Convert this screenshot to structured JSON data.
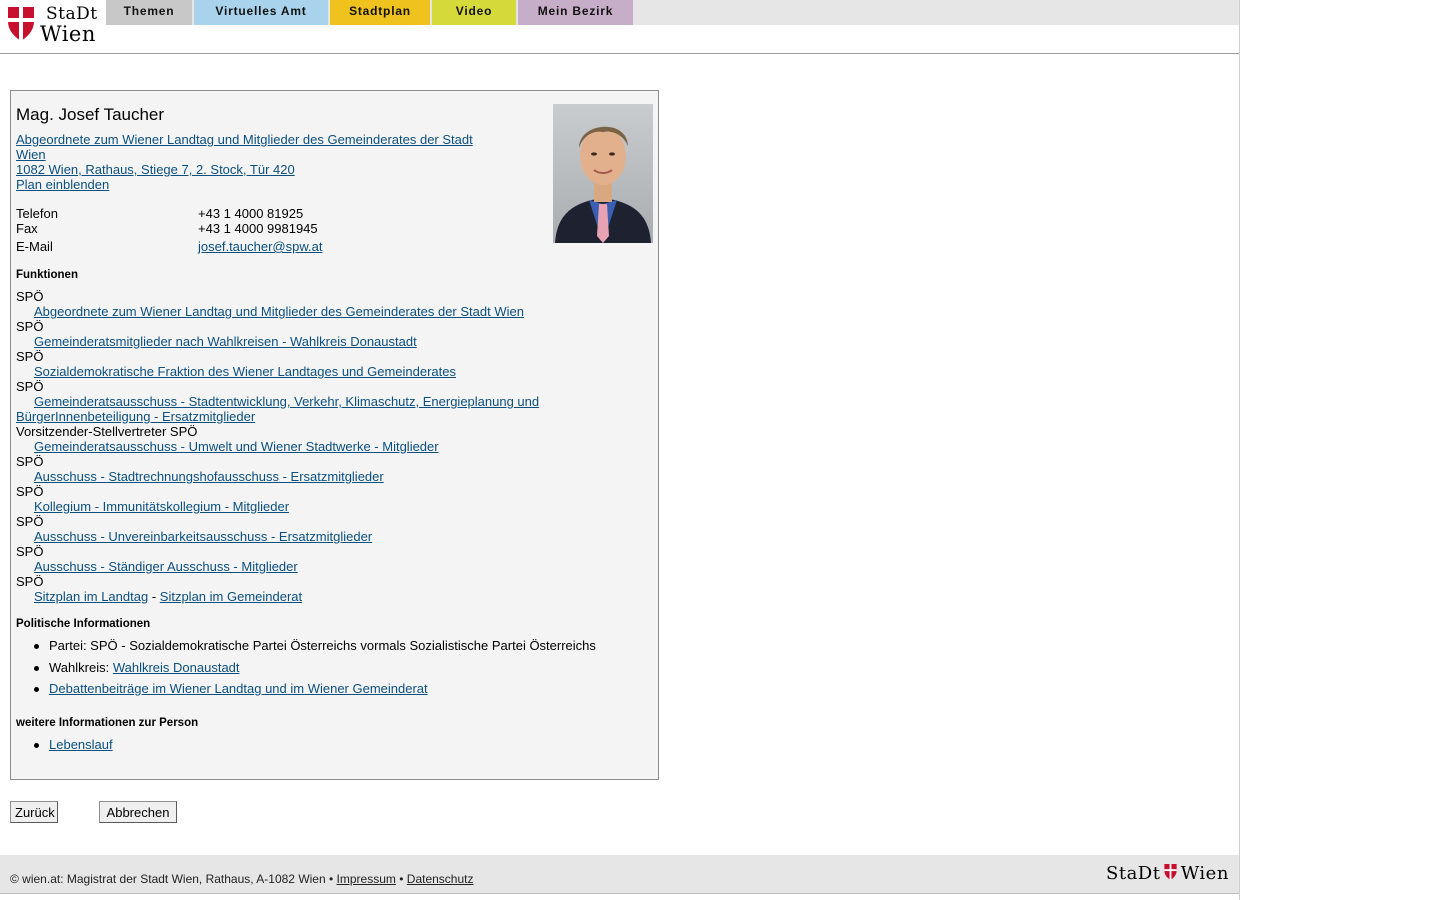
{
  "header": {
    "logo_line1": "StaDt",
    "logo_line2": "Wien",
    "nav": [
      {
        "label": "Themen",
        "color": "#c8c8c8"
      },
      {
        "label": "Virtuelles Amt",
        "color": "#a9d3ec"
      },
      {
        "label": "Stadtplan",
        "color": "#f0c21d"
      },
      {
        "label": "Video",
        "color": "#d6d93a"
      },
      {
        "label": "Mein Bezirk",
        "color": "#c7aec8"
      }
    ]
  },
  "person": {
    "name": "Mag. Josef Taucher",
    "role_link_line1": "Abgeordnete zum Wiener Landtag und Mitglieder des Gemeinderates der Stadt",
    "role_link_line2": "Wien",
    "address": "1082 Wien, Rathaus, Stiege 7, 2. Stock, Tür 420",
    "plan_link": "Plan einblenden",
    "contact": [
      {
        "label": "Telefon",
        "value": "+43 1 4000 81925"
      },
      {
        "label": "Fax",
        "value": "+43 1 4000 9981945"
      },
      {
        "label": "E-Mail",
        "value": "josef.taucher@spw.at"
      }
    ]
  },
  "functions": {
    "heading": "Funktionen",
    "items": [
      {
        "role": "SPÖ",
        "link": "Abgeordnete zum Wiener Landtag und Mitglieder des Gemeinderates der Stadt Wien"
      },
      {
        "role": "SPÖ",
        "link": "Gemeinderatsmitglieder nach Wahlkreisen - Wahlkreis Donaustadt"
      },
      {
        "role": "SPÖ",
        "link": "Sozialdemokratische Fraktion des Wiener Landtages und Gemeinderates"
      },
      {
        "role": "SPÖ",
        "link_line1": "Gemeinderatsausschuss - Stadtentwicklung, Verkehr, Klimaschutz, Energieplanung und",
        "link_line2": "BürgerInnenbeteiligung - Ersatzmitglieder"
      },
      {
        "role": "Vorsitzender-Stellvertreter SPÖ",
        "link": "Gemeinderatsausschuss - Umwelt und Wiener Stadtwerke - Mitglieder"
      },
      {
        "role": "SPÖ",
        "link": "Ausschuss - Stadtrechnungshofausschuss - Ersatzmitglieder"
      },
      {
        "role": "SPÖ",
        "link": "Kollegium - Immunitätskollegium - Mitglieder"
      },
      {
        "role": "SPÖ",
        "link": "Ausschuss - Unvereinbarkeitsausschuss - Ersatzmitglieder"
      },
      {
        "role": "SPÖ",
        "link": "Ausschuss - Ständiger Ausschuss - Mitglieder"
      },
      {
        "role": "SPÖ",
        "link_a": "Sitzplan im Landtag",
        "separator": "-",
        "link_b": "Sitzplan im Gemeinderat"
      }
    ]
  },
  "political": {
    "heading": "Politische Informationen",
    "party": "Partei: SPÖ - Sozialdemokratische Partei Österreichs vormals Sozialistische Partei Österreichs",
    "district_label": "Wahlkreis:",
    "district_link": "Wahlkreis Donaustadt",
    "debates_link": "Debattenbeiträge im Wiener Landtag und im Wiener Gemeinderat"
  },
  "more": {
    "heading": "weitere Informationen zur Person",
    "cv_link": "Lebenslauf"
  },
  "buttons": {
    "back": "Zurück",
    "cancel": "Abbrechen"
  },
  "footer": {
    "text": "© wien.at: Magistrat der Stadt Wien, Rathaus, A-1082 Wien",
    "sep": "•",
    "imprint": "Impressum",
    "privacy": "Datenschutz",
    "logo_left": "StaDt",
    "logo_right": "Wien"
  },
  "colors": {
    "link": "#0a4f80",
    "wien_red": "#c8102e"
  }
}
